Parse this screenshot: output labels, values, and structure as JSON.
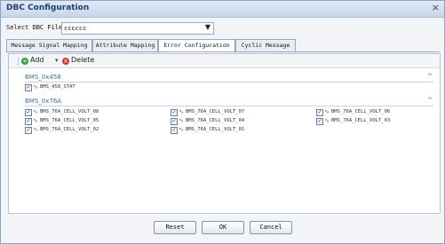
{
  "window": {
    "title": "DBC Configuration",
    "close_glyph": "×"
  },
  "dbc_file": {
    "label": "Select DBC File",
    "value": "cccccc",
    "arrow": "▼"
  },
  "tabs": [
    {
      "label": "Message Signal Mapping",
      "active": false
    },
    {
      "label": "Attribute Mapping",
      "active": false
    },
    {
      "label": "Error Configuration",
      "active": true
    },
    {
      "label": "Cyclic Message",
      "active": false
    }
  ],
  "toolbar": {
    "add_label": "Add",
    "delete_label": "Delete",
    "add_icon": "+",
    "delete_icon": "×",
    "dropdown_glyph": "▾"
  },
  "groups": [
    {
      "title": "BMS_0x458",
      "collapse_glyph": "^",
      "signals": [
        {
          "label": "BMS_458_STAT",
          "checked": true
        }
      ]
    },
    {
      "title": "BMS_0x76A",
      "collapse_glyph": "^",
      "signals": [
        {
          "label": "BMS_76A_CELL_VOLT_08",
          "checked": true
        },
        {
          "label": "BMS_76A_CELL_VOLT_07",
          "checked": true
        },
        {
          "label": "BMS_76A_CELL_VOLT_06",
          "checked": true
        },
        {
          "label": "BMS_76A_CELL_VOLT_05",
          "checked": true
        },
        {
          "label": "BMS_76A_CELL_VOLT_04",
          "checked": true
        },
        {
          "label": "BMS_76A_CELL_VOLT_03",
          "checked": true
        },
        {
          "label": "BMS_76A_CELL_VOLT_02",
          "checked": true
        },
        {
          "label": "BMS_76A_CELL_VOLT_01",
          "checked": true
        }
      ]
    }
  ],
  "footer": {
    "reset_label": "Reset",
    "ok_label": "OK",
    "cancel_label": "Cancel"
  },
  "icons": {
    "checkbox": "checkbox-icon",
    "signal": "signal-wave-icon",
    "check_glyph": "✓",
    "signal_glyph": "∿"
  },
  "colors": {
    "group_title": "#3a6ea5",
    "window_title": "#1d3e70",
    "add_icon": "#3b9c3b",
    "delete_icon": "#d23b2b"
  }
}
